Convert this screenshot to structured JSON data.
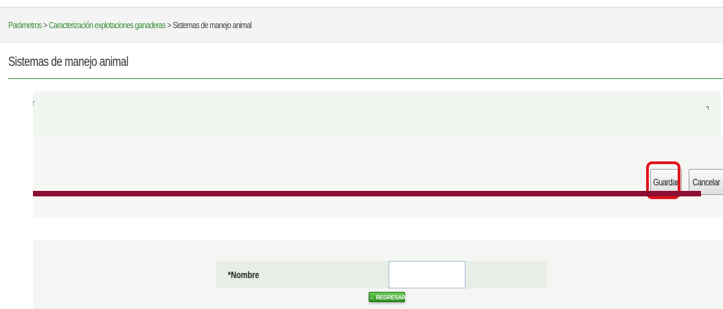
{
  "breadcrumb": {
    "items": [
      "Parámetros",
      "Caracterización explotaciones ganaderas"
    ],
    "separator": ">",
    "current": "Sistemas de manejo animal"
  },
  "page": {
    "title": "Sistemas de manejo animal"
  },
  "toolbar": {
    "save_label": "Guardar",
    "cancel_label": "Cancelar"
  },
  "form": {
    "nombre_label": "*Nombre",
    "nombre_value": "",
    "back_label": "← REGRESAR"
  },
  "colors": {
    "accent_green": "#2e8b3d",
    "divider_maroon": "#8e0f33",
    "highlight_red": "#e0141c"
  }
}
